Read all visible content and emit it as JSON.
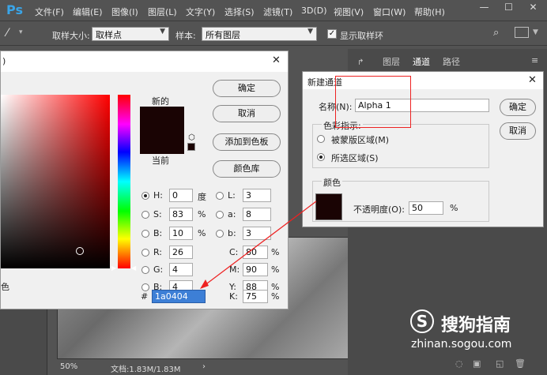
{
  "app": {
    "logo": "Ps",
    "menu": [
      "文件(F)",
      "编辑(E)",
      "图像(I)",
      "图层(L)",
      "文字(Y)",
      "选择(S)",
      "滤镜(T)",
      "3D(D)",
      "视图(V)",
      "窗口(W)",
      "帮助(H)"
    ],
    "win": {
      "min": "—",
      "max": "☐",
      "close": "✕"
    }
  },
  "options": {
    "sample_size_label": "取样大小:",
    "sample_size_value": "取样点",
    "sample_label": "样本:",
    "sample_value": "所有图层",
    "show_ring_label": "显示取样环",
    "show_ring_checked": true
  },
  "panel": {
    "tabs": [
      "图层",
      "通道",
      "路径"
    ]
  },
  "status": {
    "zoom": "50%",
    "doc": "文档:1.83M/1.83M"
  },
  "color_picker": {
    "title_fragment": ")",
    "new_label": "新的",
    "current_label": "当前",
    "ok": "确定",
    "cancel": "取消",
    "add_swatch": "添加到色板",
    "library": "颜色库",
    "fields": {
      "H": {
        "v": "0",
        "u": "度"
      },
      "S": {
        "v": "83",
        "u": "%"
      },
      "B": {
        "v": "10",
        "u": "%"
      },
      "R": {
        "v": "26"
      },
      "G": {
        "v": "4"
      },
      "Bb": {
        "v": "4"
      },
      "L": {
        "v": "3"
      },
      "a": {
        "v": "8"
      },
      "b": {
        "v": "3"
      },
      "C": {
        "v": "80",
        "u": "%"
      },
      "M": {
        "v": "90",
        "u": "%"
      },
      "Y": {
        "v": "88",
        "u": "%"
      },
      "K": {
        "v": "75",
        "u": "%"
      }
    },
    "labels": {
      "H": "H:",
      "S": "S:",
      "B": "B:",
      "R": "R:",
      "G": "G:",
      "Bb": "B:",
      "L": "L:",
      "a": "a:",
      "b": "b:",
      "C": "C:",
      "M": "M:",
      "Y": "Y:",
      "K": "K:"
    },
    "hash": "#",
    "hex": "1a0404",
    "side_text": "色",
    "color": "#1a0404",
    "hue_color": "#ff0000"
  },
  "new_channel": {
    "title": "新建通道",
    "name_label": "名称(N):",
    "name_value": "Alpha 1",
    "ok": "确定",
    "cancel": "取消",
    "color_indicates": "色彩指示:",
    "masked": "被蒙版区域(M)",
    "selected": "所选区域(S)",
    "color_group": "颜色",
    "opacity_label": "不透明度(O):",
    "opacity_value": "50",
    "opacity_unit": "%",
    "swatch": "#1a0404"
  },
  "watermark": {
    "brand": "搜狗指南",
    "url": "zhinan.sogou.com"
  }
}
